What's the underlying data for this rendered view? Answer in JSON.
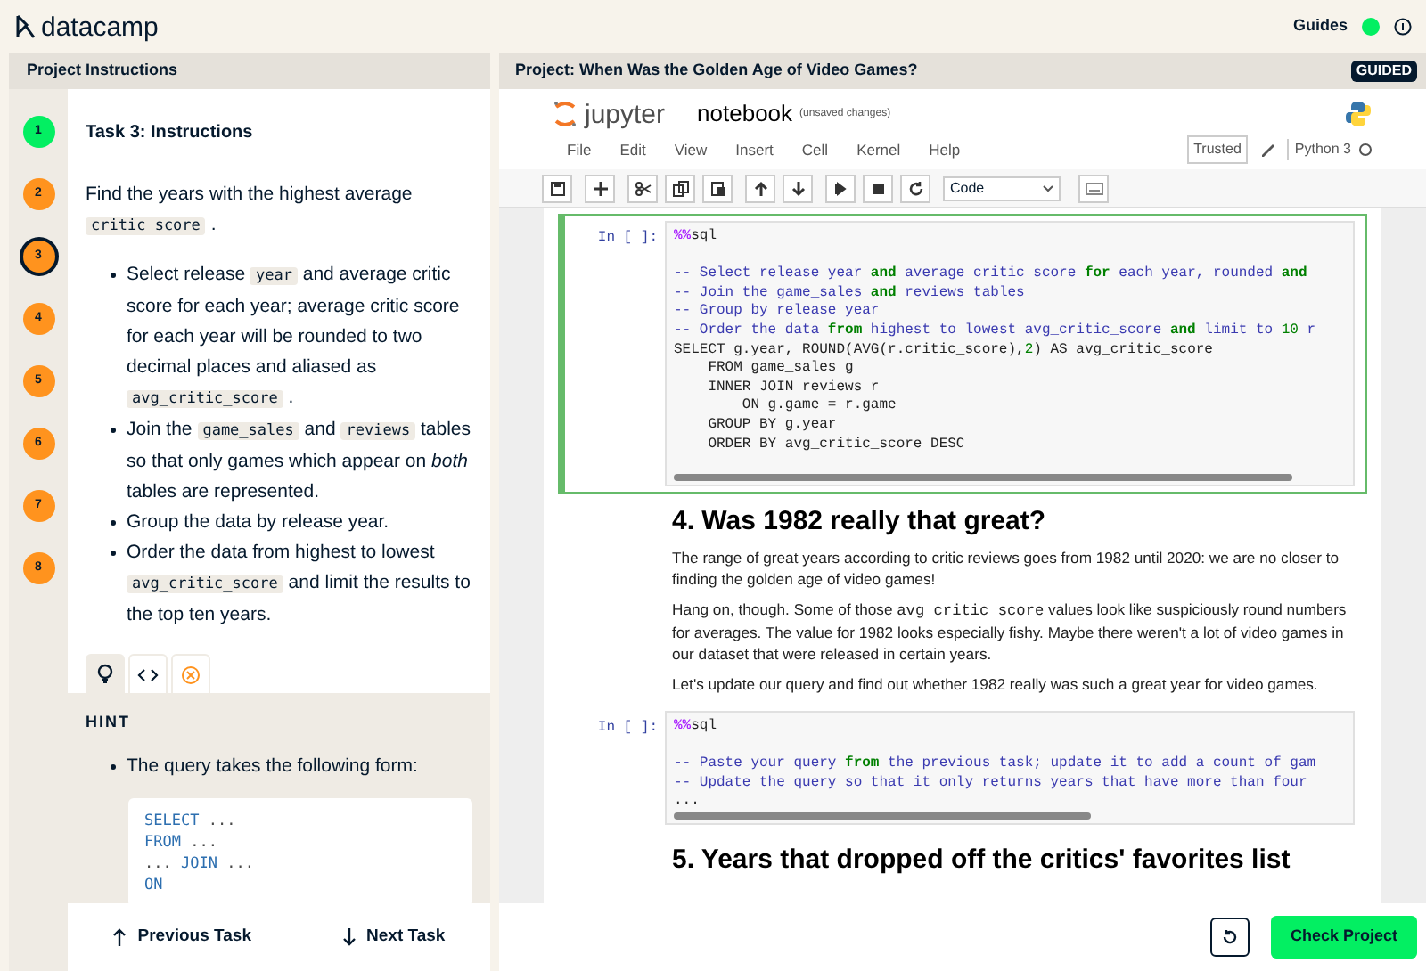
{
  "brand": {
    "name": "datacamp"
  },
  "guides": {
    "label": "Guides",
    "on": true
  },
  "instructions": {
    "header": "Project Instructions",
    "steps": [
      {
        "label": "1",
        "done": true,
        "selected": false
      },
      {
        "label": "2",
        "done": false,
        "selected": false
      },
      {
        "label": "3",
        "done": false,
        "selected": true
      },
      {
        "label": "4",
        "done": false,
        "selected": false
      },
      {
        "label": "5",
        "done": false,
        "selected": false
      },
      {
        "label": "6",
        "done": false,
        "selected": false
      },
      {
        "label": "7",
        "done": false,
        "selected": false
      },
      {
        "label": "8",
        "done": false,
        "selected": false
      }
    ],
    "task_title": "Task 3: Instructions",
    "intro": [
      {
        "kind": "text",
        "text": "Find the years with the highest average "
      },
      {
        "kind": "code",
        "text": "critic_score"
      },
      {
        "kind": "text",
        "text": " ."
      }
    ],
    "bullets": [
      [
        {
          "kind": "text",
          "text": "Select release "
        },
        {
          "kind": "code",
          "text": "year"
        },
        {
          "kind": "text",
          "text": " and average critic score for each year; average critic score for each year will be rounded to two decimal places and aliased as "
        },
        {
          "kind": "code",
          "text": "avg_critic_score"
        },
        {
          "kind": "text",
          "text": " ."
        }
      ],
      [
        {
          "kind": "text",
          "text": "Join the "
        },
        {
          "kind": "code",
          "text": "game_sales"
        },
        {
          "kind": "text",
          "text": " and "
        },
        {
          "kind": "code",
          "text": "reviews"
        },
        {
          "kind": "text",
          "text": " tables so that only games which appear on *both* tables are represented."
        }
      ],
      [
        {
          "kind": "text",
          "text": "Group the data by release year."
        }
      ],
      [
        {
          "kind": "text",
          "text": "Order the data from highest to lowest "
        },
        {
          "kind": "code",
          "text": "avg_critic_score"
        },
        {
          "kind": "text",
          "text": " and limit the results to the top ten years."
        }
      ]
    ],
    "tabs": [
      {
        "kind": "hint",
        "selected": true
      },
      {
        "kind": "code",
        "selected": false
      },
      {
        "kind": "solution",
        "selected": false
      }
    ],
    "hint": {
      "label": "HINT",
      "bullet": "The query takes the following form:",
      "code": [
        [
          {
            "kind": "keyword",
            "text": "SELECT"
          },
          {
            "kind": "plain",
            "text": " ..."
          }
        ],
        [
          {
            "kind": "keyword",
            "text": "FROM"
          },
          {
            "kind": "plain",
            "text": " ..."
          }
        ],
        [
          {
            "kind": "plain",
            "text": "... "
          },
          {
            "kind": "keyword",
            "text": "JOIN"
          },
          {
            "kind": "plain",
            "text": " ..."
          }
        ],
        [
          {
            "kind": "keyword",
            "text": "ON"
          }
        ]
      ]
    },
    "footer": {
      "previous": "Previous Task",
      "next": "Next Task"
    }
  },
  "project": {
    "title": "Project: When Was the Golden Age of Video Games?",
    "badge": "GUIDED"
  },
  "jupyter": {
    "logo": "jupyter",
    "notebook_name": "notebook",
    "save_status": "(unsaved changes)",
    "menu": [
      "File",
      "Edit",
      "View",
      "Insert",
      "Cell",
      "Kernel",
      "Help"
    ],
    "trusted": "Trusted",
    "kernel": "Python 3",
    "cell_type": "Code"
  },
  "cells": [
    {
      "kind": "code",
      "selected": true,
      "prompt": "In [ ]:",
      "lines": [
        [
          {
            "kind": "magic",
            "text": "%%"
          },
          {
            "kind": "plain",
            "text": "sql"
          }
        ],
        {
          "kind": "blank"
        },
        [
          {
            "kind": "comment",
            "text": "-- Select release year "
          },
          {
            "kind": "keyword",
            "text": "and"
          },
          {
            "kind": "comment",
            "text": " average critic score "
          },
          {
            "kind": "keyword",
            "text": "for"
          },
          {
            "kind": "comment",
            "text": " each year, rounded "
          },
          {
            "kind": "keyword",
            "text": "and"
          }
        ],
        [
          {
            "kind": "comment",
            "text": "-- Join the game_sales "
          },
          {
            "kind": "keyword",
            "text": "and"
          },
          {
            "kind": "comment",
            "text": " reviews tables"
          }
        ],
        [
          {
            "kind": "comment",
            "text": "-- Group by release year"
          }
        ],
        [
          {
            "kind": "comment",
            "text": "-- Order the data "
          },
          {
            "kind": "keyword",
            "text": "from"
          },
          {
            "kind": "comment",
            "text": " highest to lowest avg_critic_score "
          },
          {
            "kind": "keyword",
            "text": "and"
          },
          {
            "kind": "comment",
            "text": " limit to "
          },
          {
            "kind": "number",
            "text": "10"
          },
          {
            "kind": "comment",
            "text": " r"
          }
        ],
        [
          {
            "kind": "plain",
            "text": "SELECT g.year, ROUND(AVG(r.critic_score),"
          },
          {
            "kind": "number",
            "text": "2"
          },
          {
            "kind": "plain",
            "text": ") AS avg_critic_score"
          }
        ],
        [
          {
            "kind": "plain",
            "text": "    FROM game_sales g"
          }
        ],
        [
          {
            "kind": "plain",
            "text": "    INNER JOIN reviews r"
          }
        ],
        [
          {
            "kind": "plain",
            "text": "        ON g.game = r.game"
          }
        ],
        [
          {
            "kind": "plain",
            "text": "    GROUP BY g.year"
          }
        ],
        [
          {
            "kind": "plain",
            "text": "    ORDER BY avg_critic_score DESC"
          }
        ],
        {
          "kind": "blank"
        }
      ]
    },
    {
      "kind": "heading",
      "text": "4. Was 1982 really that great?"
    },
    {
      "kind": "paragraph",
      "segments": [
        {
          "kind": "text",
          "text": "The range of great years according to critic reviews goes from 1982 until 2020: we are no closer to finding the golden age of video games!"
        }
      ]
    },
    {
      "kind": "paragraph",
      "segments": [
        {
          "kind": "text",
          "text": "Hang on, though. Some of those "
        },
        {
          "kind": "code",
          "text": "avg_critic_score"
        },
        {
          "kind": "text",
          "text": " values look like suspiciously round numbers for averages. The value for 1982 looks especially fishy. Maybe there weren't a lot of video games in our dataset that were released in certain years."
        }
      ]
    },
    {
      "kind": "paragraph",
      "segments": [
        {
          "kind": "text",
          "text": "Let's update our query and find out whether 1982 really was such a great year for video games."
        }
      ]
    },
    {
      "kind": "code",
      "selected": false,
      "prompt": "In [ ]:",
      "lines": [
        [
          {
            "kind": "magic",
            "text": "%%"
          },
          {
            "kind": "plain",
            "text": "sql"
          }
        ],
        {
          "kind": "blank"
        },
        [
          {
            "kind": "comment",
            "text": "-- Paste your query "
          },
          {
            "kind": "keyword",
            "text": "from"
          },
          {
            "kind": "comment",
            "text": " the previous task; update it to add a count of gam"
          }
        ],
        [
          {
            "kind": "comment",
            "text": "-- Update the query so that it only returns years that have more than four"
          }
        ],
        [
          {
            "kind": "plain",
            "text": "..."
          }
        ]
      ]
    },
    {
      "kind": "heading",
      "text": "5. Years that dropped off the critics' favorites list"
    }
  ],
  "actions": {
    "check": "Check Project"
  }
}
